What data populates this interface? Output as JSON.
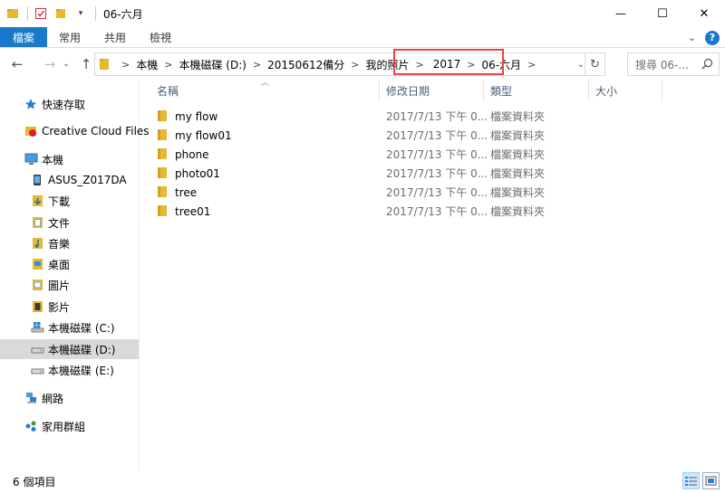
{
  "window": {
    "title": "06-六月",
    "controls": {
      "minimize": "—",
      "maximize": "☐",
      "close": "✕"
    }
  },
  "ribbon": {
    "tabs": [
      "檔案",
      "常用",
      "共用",
      "檢視"
    ]
  },
  "address": {
    "crumbs": [
      "本機",
      "本機磁碟 (D:)",
      "20150612備分",
      "我的照片",
      "2017",
      "06-六月"
    ]
  },
  "search": {
    "placeholder": "搜尋 06-..."
  },
  "sidebar": {
    "items": [
      {
        "label": "快速存取",
        "icon": "star-icon"
      },
      {
        "label": "Creative Cloud Files",
        "icon": "creative-cloud-icon"
      },
      {
        "label": "本機",
        "icon": "computer-icon"
      },
      {
        "label": "ASUS_Z017DA",
        "icon": "phone-icon"
      },
      {
        "label": "下載",
        "icon": "download-folder-icon"
      },
      {
        "label": "文件",
        "icon": "documents-folder-icon"
      },
      {
        "label": "音樂",
        "icon": "music-folder-icon"
      },
      {
        "label": "桌面",
        "icon": "desktop-folder-icon"
      },
      {
        "label": "圖片",
        "icon": "pictures-folder-icon"
      },
      {
        "label": "影片",
        "icon": "videos-folder-icon"
      },
      {
        "label": "本機磁碟 (C:)",
        "icon": "windows-drive-icon"
      },
      {
        "label": "本機磁碟 (D:)",
        "icon": "drive-icon"
      },
      {
        "label": "本機磁碟 (E:)",
        "icon": "drive-icon"
      },
      {
        "label": "網路",
        "icon": "network-icon"
      },
      {
        "label": "家用群組",
        "icon": "homegroup-icon"
      }
    ]
  },
  "columns": {
    "name": "名稱",
    "date": "修改日期",
    "type": "類型",
    "size": "大小"
  },
  "files": [
    {
      "name": "my flow",
      "date": "2017/7/13 下午 0...",
      "type": "檔案資料夾"
    },
    {
      "name": "my flow01",
      "date": "2017/7/13 下午 0...",
      "type": "檔案資料夾"
    },
    {
      "name": "phone",
      "date": "2017/7/13 下午 0...",
      "type": "檔案資料夾"
    },
    {
      "name": "photo01",
      "date": "2017/7/13 下午 0...",
      "type": "檔案資料夾"
    },
    {
      "name": "tree",
      "date": "2017/7/13 下午 0...",
      "type": "檔案資料夾"
    },
    {
      "name": "tree01",
      "date": "2017/7/13 下午 0...",
      "type": "檔案資料夾"
    }
  ],
  "status": {
    "count": "6 個項目"
  },
  "colors": {
    "accent": "#1979ca",
    "highlight": "#e64545",
    "folder": "#e8b830"
  }
}
